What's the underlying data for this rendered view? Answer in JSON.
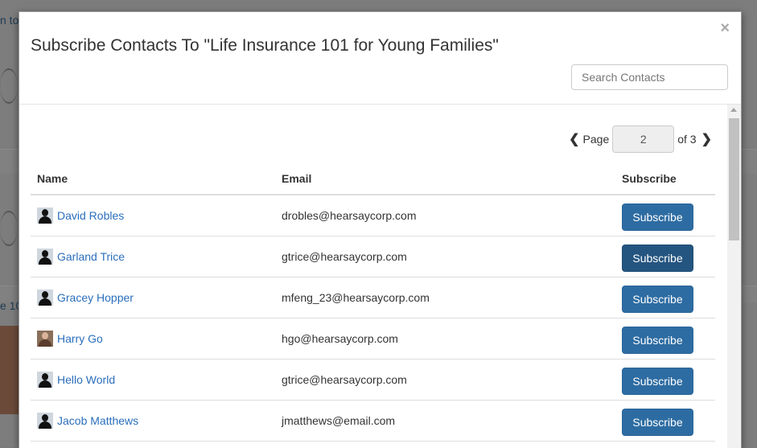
{
  "background": {
    "text_top": "n to",
    "text_mid": "e 10"
  },
  "modal": {
    "title": "Subscribe Contacts To \"Life Insurance 101 for Young Families\"",
    "close_glyph": "×",
    "search": {
      "placeholder": "Search Contacts",
      "value": ""
    }
  },
  "pagination": {
    "prev_glyph": "❮",
    "page_label": "Page",
    "current_page": "2",
    "of_label": "of 3",
    "next_glyph": "❯"
  },
  "table": {
    "headers": {
      "name": "Name",
      "email": "Email",
      "subscribe": "Subscribe"
    },
    "rows": [
      {
        "name": "David Robles",
        "email": "drobles@hearsaycorp.com",
        "button": "Subscribe",
        "avatar": "silhouette"
      },
      {
        "name": "Garland Trice",
        "email": "gtrice@hearsaycorp.com",
        "button": "Subscribe",
        "avatar": "silhouette"
      },
      {
        "name": "Gracey Hopper",
        "email": "mfeng_23@hearsaycorp.com",
        "button": "Subscribe",
        "avatar": "silhouette"
      },
      {
        "name": "Harry Go",
        "email": "hgo@hearsaycorp.com",
        "button": "Subscribe",
        "avatar": "photo"
      },
      {
        "name": "Hello World",
        "email": "gtrice@hearsaycorp.com",
        "button": "Subscribe",
        "avatar": "silhouette"
      },
      {
        "name": "Jacob Matthews",
        "email": "jmatthews@email.com",
        "button": "Subscribe",
        "avatar": "silhouette"
      }
    ]
  },
  "colors": {
    "link": "#2a6ebb",
    "button_primary": "#2d6ca2",
    "button_active": "#245580",
    "overlay": "#7d7d7d"
  }
}
